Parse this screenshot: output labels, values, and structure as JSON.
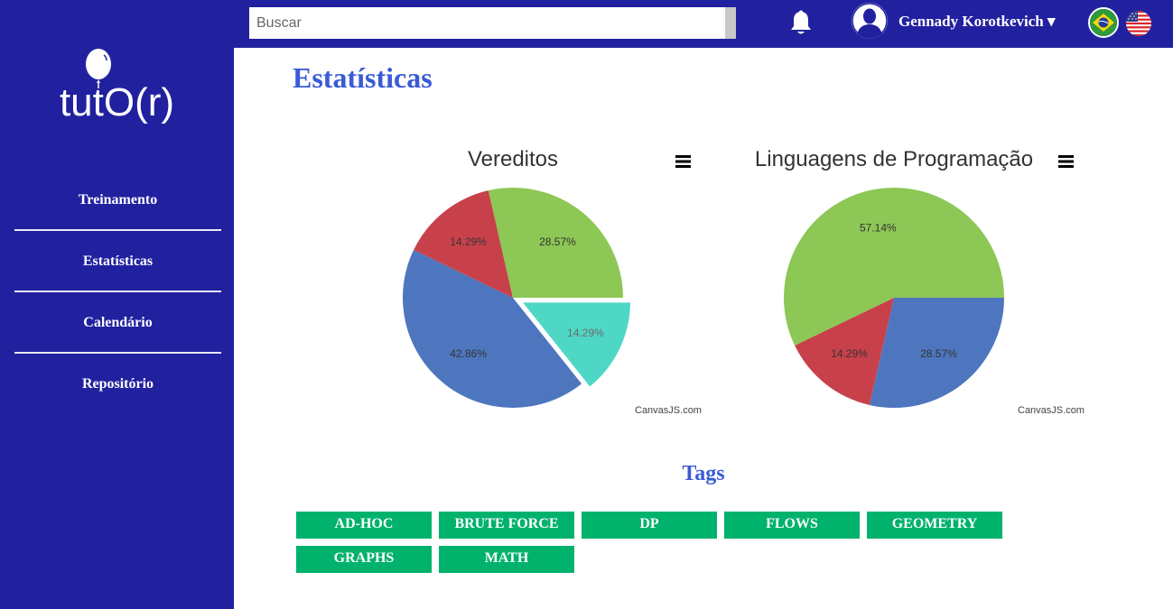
{
  "sidebar": {
    "logo_text": "tutO(r)",
    "items": [
      {
        "label": "Treinamento"
      },
      {
        "label": "Estatísticas"
      },
      {
        "label": "Calendário"
      },
      {
        "label": "Repositório"
      }
    ]
  },
  "topbar": {
    "search_placeholder": "Buscar",
    "user_name": "Gennady Korotkevich ▾",
    "icons": [
      "bell-icon",
      "avatar-icon",
      "flag-brazil-icon",
      "flag-usa-icon"
    ]
  },
  "page": {
    "title": "Estatísticas",
    "tags_title": "Tags",
    "tags": [
      "AD-HOC",
      "BRUTE FORCE",
      "DP",
      "FLOWS",
      "GEOMETRY",
      "GRAPHS",
      "MATH"
    ]
  },
  "colors": {
    "sidebar": "#2121a0",
    "title": "#3a5bd6",
    "tag": "#00b26c",
    "slice_green": "#8dc756",
    "slice_teal": "#4fd7c6",
    "slice_red": "#c8414a",
    "slice_blue": "#4e76bf"
  },
  "chart_data": [
    {
      "type": "pie",
      "title": "Vereditos",
      "credit": "CanvasJS.com",
      "slices": [
        {
          "value": 14.29,
          "label": "14.29%",
          "color": "#4fd7c6",
          "exploded": true
        },
        {
          "value": 42.86,
          "label": "42.86%",
          "color": "#4e76bf"
        },
        {
          "value": 14.29,
          "label": "14.29%",
          "color": "#c8414a"
        },
        {
          "value": 28.57,
          "label": "28.57%",
          "color": "#8dc756"
        }
      ]
    },
    {
      "type": "pie",
      "title": "Linguagens de Programação",
      "credit": "CanvasJS.com",
      "slices": [
        {
          "value": 28.57,
          "label": "28.57%",
          "color": "#4e76bf"
        },
        {
          "value": 14.29,
          "label": "14.29%",
          "color": "#c8414a"
        },
        {
          "value": 57.14,
          "label": "57.14%",
          "color": "#8dc756"
        }
      ]
    }
  ]
}
